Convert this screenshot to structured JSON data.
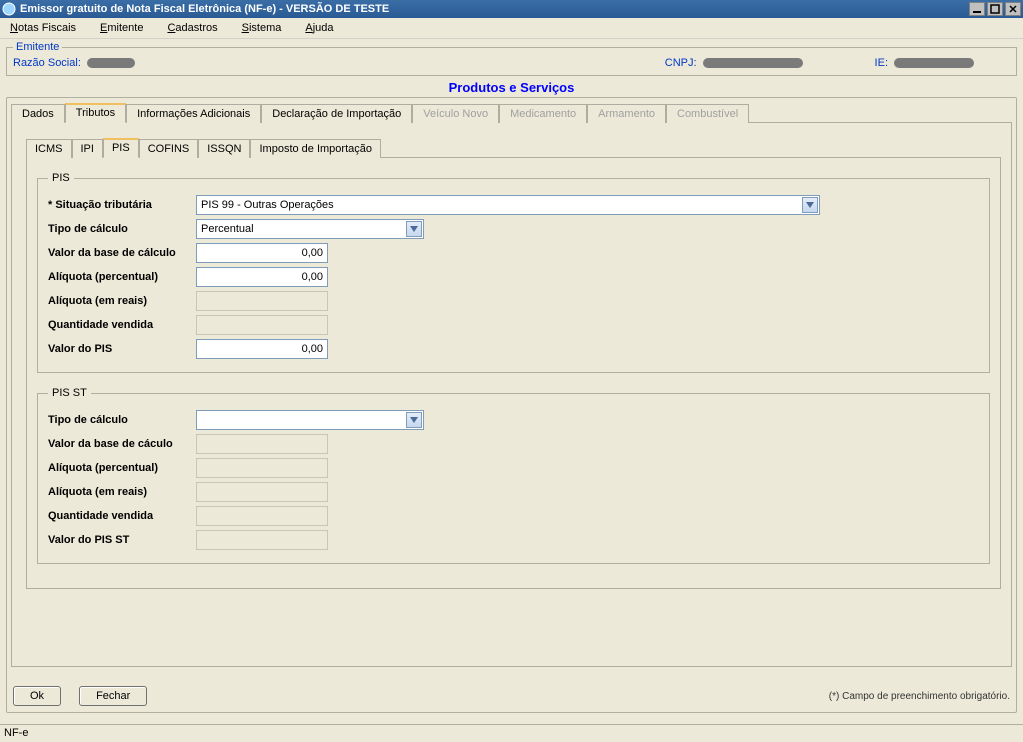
{
  "window": {
    "title": "Emissor gratuito de Nota Fiscal Eletrônica (NF-e) - VERSÃO DE TESTE"
  },
  "menu": {
    "notas": "Notas Fiscais",
    "emitente": "Emitente",
    "cadastros": "Cadastros",
    "sistema": "Sistema",
    "ajuda": "Ajuda"
  },
  "emitente": {
    "legend": "Emitente",
    "razao_lbl": "Razão Social:",
    "cnpj_lbl": "CNPJ:",
    "ie_lbl": "IE:"
  },
  "section_title": "Produtos e Serviços",
  "tabs": {
    "dados": "Dados",
    "tributos": "Tributos",
    "info": "Informações Adicionais",
    "decl": "Declaração de Importação",
    "veiculo": "Veículo Novo",
    "medic": "Medicamento",
    "arma": "Armamento",
    "comb": "Combustível"
  },
  "subtabs": {
    "icms": "ICMS",
    "ipi": "IPI",
    "pis": "PIS",
    "cofins": "COFINS",
    "issqn": "ISSQN",
    "imp": "Imposto de Importação"
  },
  "pis": {
    "legend": "PIS",
    "situacao_lbl": "* Situação tributária",
    "situacao_val": "PIS 99 - Outras Operações",
    "tipo_lbl": "Tipo de cálculo",
    "tipo_val": "Percentual",
    "base_lbl": "Valor da base de cálculo",
    "base_val": "0,00",
    "aliq_perc_lbl": "Alíquota (percentual)",
    "aliq_perc_val": "0,00",
    "aliq_reais_lbl": "Alíquota (em reais)",
    "aliq_reais_val": "",
    "qtd_lbl": "Quantidade vendida",
    "qtd_val": "",
    "valor_lbl": "Valor do PIS",
    "valor_val": "0,00"
  },
  "pisst": {
    "legend": "PIS ST",
    "tipo_lbl": "Tipo de cálculo",
    "tipo_val": "",
    "base_lbl": "Valor da base de cáculo",
    "base_val": "",
    "aliq_perc_lbl": "Alíquota (percentual)",
    "aliq_perc_val": "",
    "aliq_reais_lbl": "Alíquota (em reais)",
    "aliq_reais_val": "",
    "qtd_lbl": "Quantidade vendida",
    "qtd_val": "",
    "valor_lbl": "Valor do PIS ST",
    "valor_val": ""
  },
  "buttons": {
    "ok": "Ok",
    "fechar": "Fechar"
  },
  "note": "(*) Campo de preenchimento obrigatório.",
  "status": "NF-e"
}
